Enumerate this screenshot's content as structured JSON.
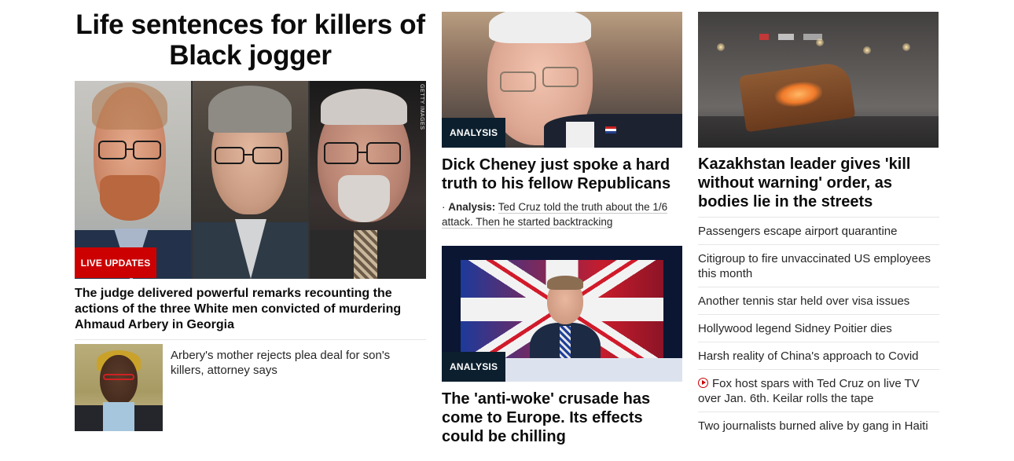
{
  "lead": {
    "headline": "Life sentences for killers of Black jogger",
    "image_credit": "GETTY IMAGES",
    "badge": "LIVE UPDATES",
    "description": "The judge delivered powerful remarks recounting the actions of the three White men convicted of murdering Ahmaud Arbery in Georgia",
    "related": {
      "title": "Arbery's mother rejects plea deal for son's killers, attorney says"
    }
  },
  "middle": {
    "cards": [
      {
        "badge": "ANALYSIS",
        "title": "Dick Cheney just spoke a hard truth to his fellow Republicans",
        "related_label": "Analysis:",
        "related_text": "Ted Cruz told the truth about the 1/6 attack. Then he started backtracking"
      },
      {
        "badge": "ANALYSIS",
        "title": "The 'anti-woke' crusade has come to Europe. Its effects could be chilling"
      }
    ]
  },
  "right": {
    "title": "Kazakhstan leader gives 'kill without warning' order, as bodies lie in the streets",
    "links": [
      "Passengers escape airport quarantine",
      "Citigroup to fire unvaccinated US employees this month",
      "Another tennis star held over visa issues",
      "Hollywood legend Sidney Poitier dies",
      "Harsh reality of China's approach to Covid",
      "Fox host spars with Ted Cruz on live TV over Jan. 6th. Keilar rolls the tape",
      "Two journalists burned alive by gang in Haiti"
    ],
    "video_link_index": 5
  },
  "colors": {
    "live_badge": "#cc0000",
    "analysis_badge": "#0c1f2e",
    "text": "#0c0c0c",
    "divider": "#e6e6e6"
  }
}
